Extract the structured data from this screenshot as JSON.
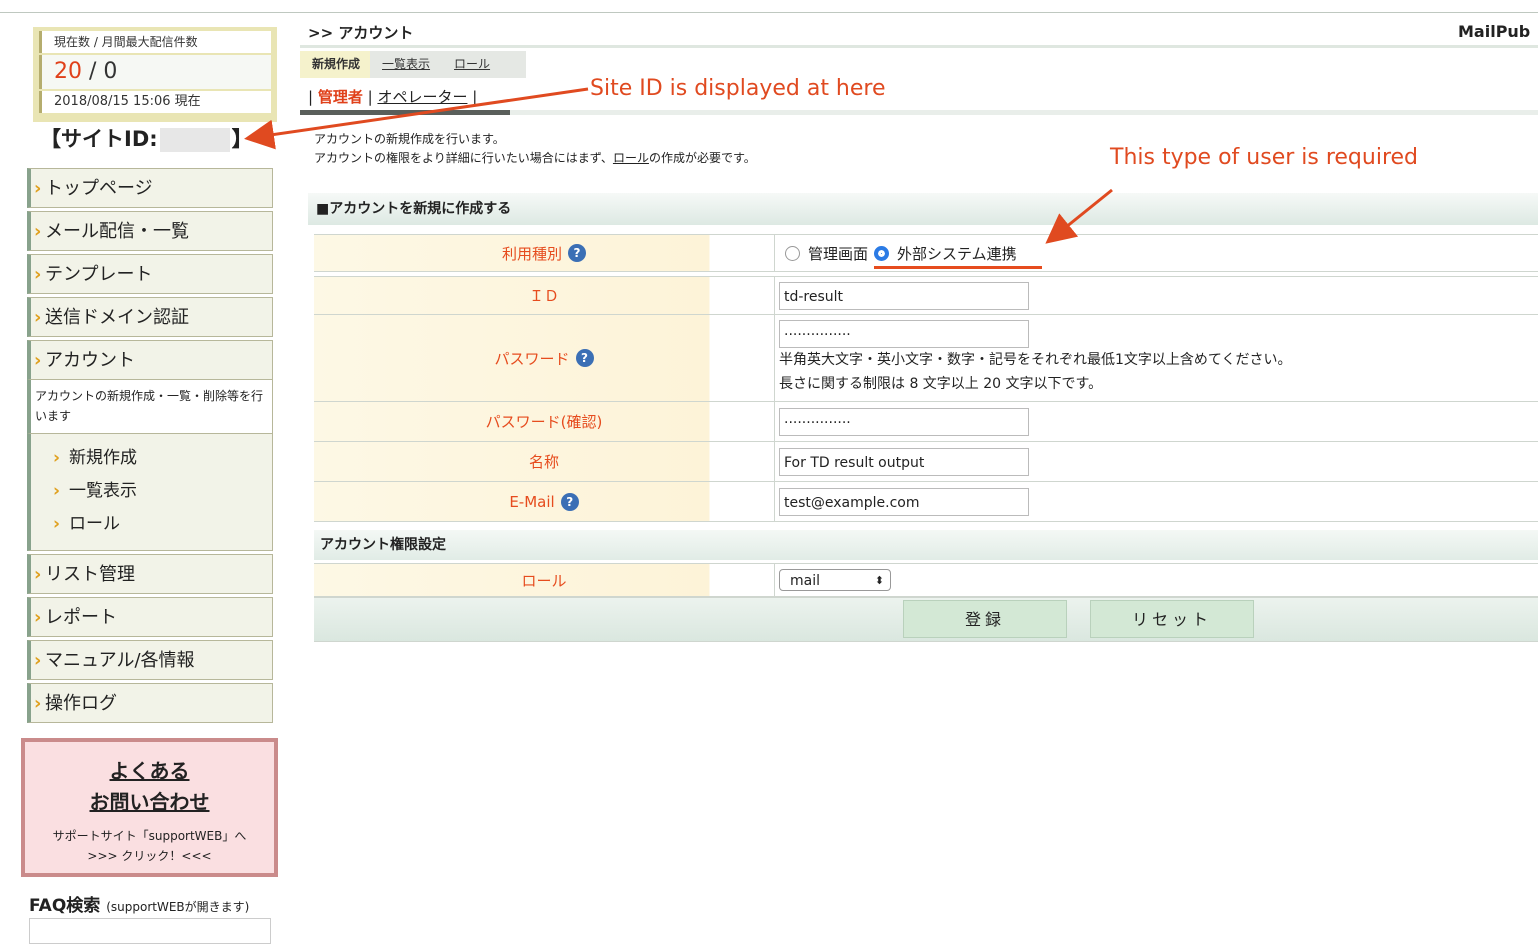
{
  "counter": {
    "label": "現在数 / 月間最大配信件数",
    "current": "20",
    "separator": " / ",
    "max": "0",
    "timestamp": "2018/08/15 15:06 現在"
  },
  "site_id": {
    "prefix": "【サイトID:",
    "suffix": "】"
  },
  "sidebar": {
    "items": [
      {
        "label": "トップページ"
      },
      {
        "label": "メール配信・一覧"
      },
      {
        "label": "テンプレート"
      },
      {
        "label": "送信ドメイン認証"
      },
      {
        "label": "アカウント"
      },
      {
        "label": "リスト管理"
      },
      {
        "label": "レポート"
      },
      {
        "label": "マニュアル/各情報"
      },
      {
        "label": "操作ログ"
      }
    ],
    "account_desc": "アカウントの新規作成・一覧・削除等を行います",
    "account_sub": [
      {
        "label": "新規作成"
      },
      {
        "label": "一覧表示"
      },
      {
        "label": "ロール"
      }
    ]
  },
  "faq_box": {
    "line1": "よくある",
    "line2": "お問い合わせ",
    "line3": "サポートサイト「supportWEB」へ",
    "line4": ">>> クリック！<<<"
  },
  "faq_search": {
    "title": "FAQ検索",
    "note": "(supportWEBが開きます)"
  },
  "header": {
    "breadcrumb": ">> アカウント",
    "brand": "MailPub",
    "tabs": [
      {
        "label": "新規作成"
      },
      {
        "label": "一覧表示"
      },
      {
        "label": "ロール"
      }
    ],
    "role_tabs": {
      "active": "管理者",
      "other": "オペレーター"
    }
  },
  "description": {
    "line1": "アカウントの新規作成を行います。",
    "line2a": "アカウントの権限をより詳細に行いたい場合にはまず、",
    "line2link": "ロール",
    "line2b": "の作成が必要です。"
  },
  "section_title": "■アカウントを新規に作成する",
  "form": {
    "usage_label": "利用種別",
    "usage_options": [
      "管理画面",
      "外部システム連携"
    ],
    "usage_selected": "外部システム連携",
    "id_label": "ＩＤ",
    "id_value": "td-result",
    "password_label": "パスワード",
    "password_value": "···············",
    "password_note1": "半角英大文字・英小文字・数字・記号をそれぞれ最低1文字以上含めてください。",
    "password_note2": "長さに関する制限は 8 文字以上 20 文字以下です。",
    "password_confirm_label": "パスワード(確認)",
    "password_confirm_value": "···············",
    "name_label": "名称",
    "name_value": "For TD result output",
    "email_label": "E-Mail",
    "email_value": "test@example.com",
    "perm_title": "アカウント権限設定",
    "role_label": "ロール",
    "role_value": "mail",
    "submit_label": "登録",
    "reset_label": "リセット",
    "help_icon": "?"
  },
  "annotations": {
    "site_id_note": "Site ID is displayed at here",
    "user_type_note": "This type of user is required",
    "color": "#e04a20"
  }
}
